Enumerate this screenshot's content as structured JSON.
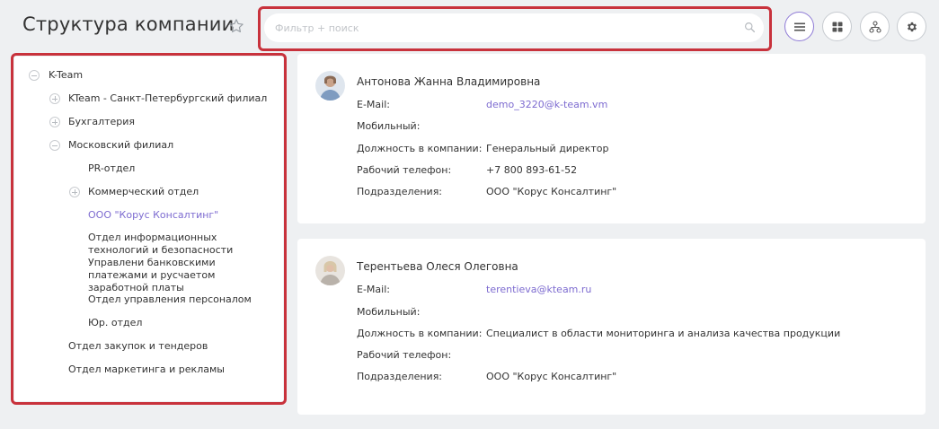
{
  "header": {
    "title": "Структура компании",
    "search_placeholder": "Фильтр + поиск"
  },
  "view_buttons": [
    {
      "name": "list-view",
      "icon": "list-icon",
      "active": true
    },
    {
      "name": "grid-view",
      "icon": "grid-icon",
      "active": false
    },
    {
      "name": "tree-view",
      "icon": "org-chart-icon",
      "active": false
    },
    {
      "name": "settings",
      "icon": "gear-icon",
      "active": false
    }
  ],
  "tree": {
    "root": "K-Team",
    "items": [
      "KTeam - Санкт-Петербургский филиал",
      "Бухгалтерия",
      "Московский филиал",
      "PR-отдел",
      "Коммерческий отдел",
      "ООО \"Корус Консалтинг\"",
      "Отдел информационных технологий и безопасности Управлени банковскими платежами и русчаетом заработной платы",
      "Отдел управления персоналом",
      "Юр. отдел",
      "Отдел закупок и тендеров",
      "Отдел маркетинга и рекламы"
    ]
  },
  "labels": {
    "email": "E-Mail:",
    "mobile": "Мобильный:",
    "position": "Должность в компании:",
    "work_phone": "Рабочий телефон:",
    "department": "Подразделения:"
  },
  "employees": [
    {
      "name": "Антонова Жанна Владимировна",
      "email": "demo_3220@k-team.vm",
      "mobile": "",
      "position": "Генеральный директор",
      "work_phone": "+7 800 893-61-52",
      "department": "ООО \"Корус Консалтинг\""
    },
    {
      "name": "Терентьева Олеся Олеговна",
      "email": "terentieva@kteam.ru",
      "mobile": "",
      "position": "Специалист в области мониторинга и анализа качества продукции",
      "work_phone": "",
      "department": "ООО \"Корус Консалтинг\""
    }
  ],
  "colors": {
    "accent": "#7d6bd0",
    "highlight": "#c8323c",
    "background": "#eef0f2"
  }
}
